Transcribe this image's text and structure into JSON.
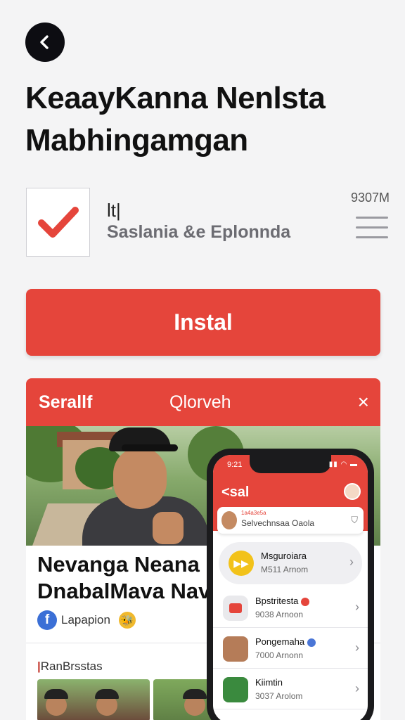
{
  "header": {
    "title_line1": "KeaayKanna Nenlsta",
    "title_line2": "Mabhingamgan"
  },
  "app": {
    "developer": "lt|",
    "subtitle": "Saslania &e Eplonnda",
    "size": "9307M",
    "install_label": "Instal"
  },
  "promo": {
    "tab1": "Serallf",
    "tab2": "Qlorveh",
    "close": "×",
    "card_title_line1": "Nevanga Neana",
    "card_title_line2": "DnabalMava Nav",
    "social_label": "Lapapion",
    "section_label": "RanBrsstas"
  },
  "phone": {
    "time": "9:21",
    "header": "<sal",
    "banner_tag": "1a4a3e5a",
    "banner_text": "Selvechnsaa Oaola",
    "items": [
      {
        "title": "Msguroiara",
        "sub": "M511 Arnom",
        "color": "#f2c21a"
      },
      {
        "title": "Bpstritesta",
        "sub": "9038 Arnoon",
        "color": "#e5453b"
      },
      {
        "title": "Pongemaha",
        "sub": "7000 Arnonn",
        "color": "#4a76d6"
      },
      {
        "title": "Kiimtin",
        "sub": "3037 Arolom",
        "color": "#3a8a3e"
      }
    ]
  }
}
